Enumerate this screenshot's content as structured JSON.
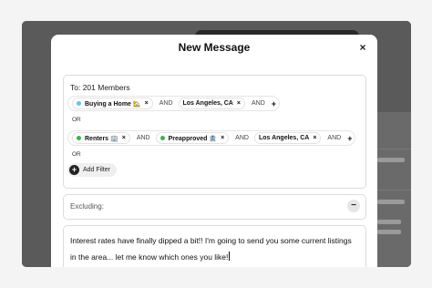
{
  "modal": {
    "title": "New Message",
    "close_icon": "×"
  },
  "recipients": {
    "to_label": "To: 201 Members",
    "row1": [
      {
        "label": "Buying a Home 🏡",
        "dot_color": "#5ec8e6"
      },
      {
        "connector": "AND"
      },
      {
        "label": "Los Angeles, CA"
      },
      {
        "connector": "AND"
      }
    ],
    "or_label_1": "OR",
    "row2": [
      {
        "label": "Renters 🏢",
        "dot_color": "#3bb44a"
      },
      {
        "connector": "AND"
      },
      {
        "label": "Preapproved 🏦",
        "dot_color": "#3bb44a"
      },
      {
        "connector": "AND"
      },
      {
        "label": "Los Angeles, CA"
      },
      {
        "connector": "AND"
      }
    ],
    "or_label_2": "OR",
    "add_filter_label": "Add Filter",
    "chip_close": "×",
    "plus": "+"
  },
  "excluding": {
    "label": "Excluding:",
    "minus": "−"
  },
  "message": {
    "text": "Interest rates have finally dipped a bit!! I'm going to send you some current listings in the area... let me know which ones you like!"
  },
  "colors": {
    "overlay": "#505050",
    "accent_dot_blue": "#5ec8e6",
    "accent_dot_green": "#3bb44a"
  }
}
